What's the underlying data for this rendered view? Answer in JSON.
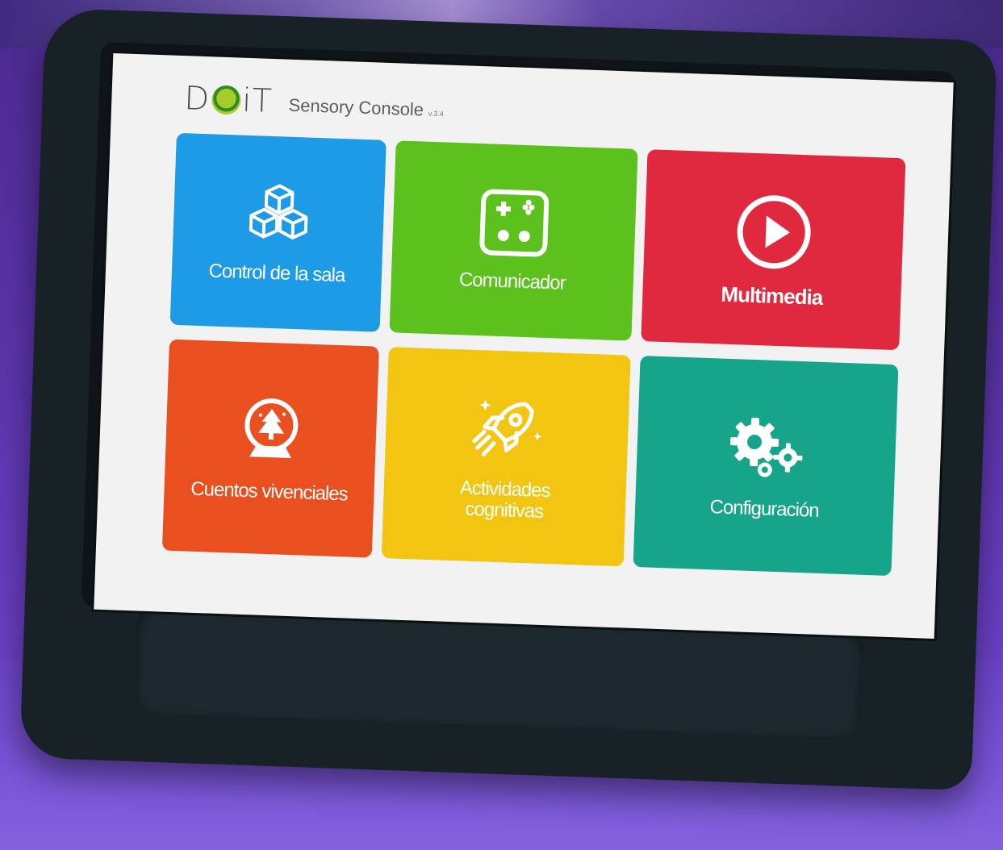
{
  "header": {
    "logo_text_left": "D",
    "logo_text_right": "iT",
    "app_title": "Sensory Console",
    "version": "v.3.4"
  },
  "tiles": [
    {
      "label": "Control de la sala",
      "icon": "cubes-icon",
      "color": "#1e9be6"
    },
    {
      "label": "Comunicador",
      "icon": "gamepad-icon",
      "color": "#5cc11c"
    },
    {
      "label": "Multimedia",
      "icon": "play-icon",
      "color": "#e0283f"
    },
    {
      "label": "Cuentos vivenciales",
      "icon": "snow-globe-icon",
      "color": "#ea4f20"
    },
    {
      "label_line1": "Actividades",
      "label_line2": "cognitivas",
      "icon": "rocket-icon",
      "color": "#f2c511"
    },
    {
      "label": "Configuración",
      "icon": "gears-icon",
      "color": "#16a58a"
    }
  ]
}
